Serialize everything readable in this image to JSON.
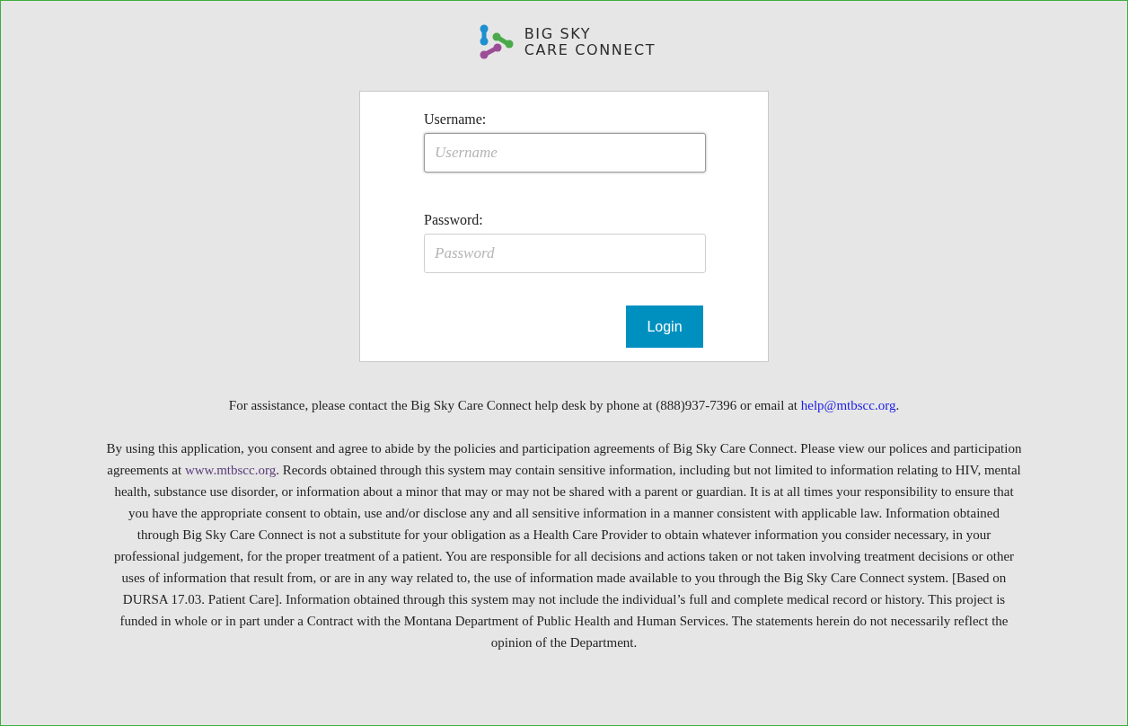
{
  "logo": {
    "line_1": "BIG SKY",
    "line_2": "CARE CONNECT"
  },
  "login_form": {
    "fields": [
      {
        "label": "Username:",
        "placeholder": "Username",
        "focused": true
      },
      {
        "label": "Password:",
        "placeholder": "Password",
        "focused": false
      }
    ],
    "button": "Login"
  },
  "assistance": {
    "before": "For assistance, please contact the Big Sky Care Connect help desk by phone at (888)937-7396 or email at ",
    "link": "help@mtbscc.org",
    "after": "."
  },
  "disclaimer": {
    "before": "By using this application, you consent and agree to abide by the policies and participation agreements of Big Sky Care Connect. Please view our polices and participation agreements at ",
    "link": "www.mtbscc.org",
    "after": ". Records obtained through this system may contain sensitive information, including but not limited to information relating to HIV, mental health, substance use disorder, or information about a minor that may or may not be shared with a parent or guardian. It is at all times your responsibility to ensure that you have the appropriate consent to obtain, use and/or disclose any and all sensitive information in a manner consistent with applicable law. Information obtained through Big Sky Care Connect is not a substitute for your obligation as a Health Care Provider to obtain whatever information you consider necessary, in your professional judgement, for the proper treatment of a patient. You are responsible for all decisions and actions taken or not taken involving treatment decisions or other uses of information that result from, or are in any way related to, the use of information made available to you through the Big Sky Care Connect system. [Based on DURSA 17.03. Patient Care]. Information obtained through this system may not include the individual’s full and complete medical record or history. This project is funded in whole or in part under a Contract with the Montana Department of Public Health and Human Services. The statements herein do not necessarily reflect the opinion of the Department."
  }
}
